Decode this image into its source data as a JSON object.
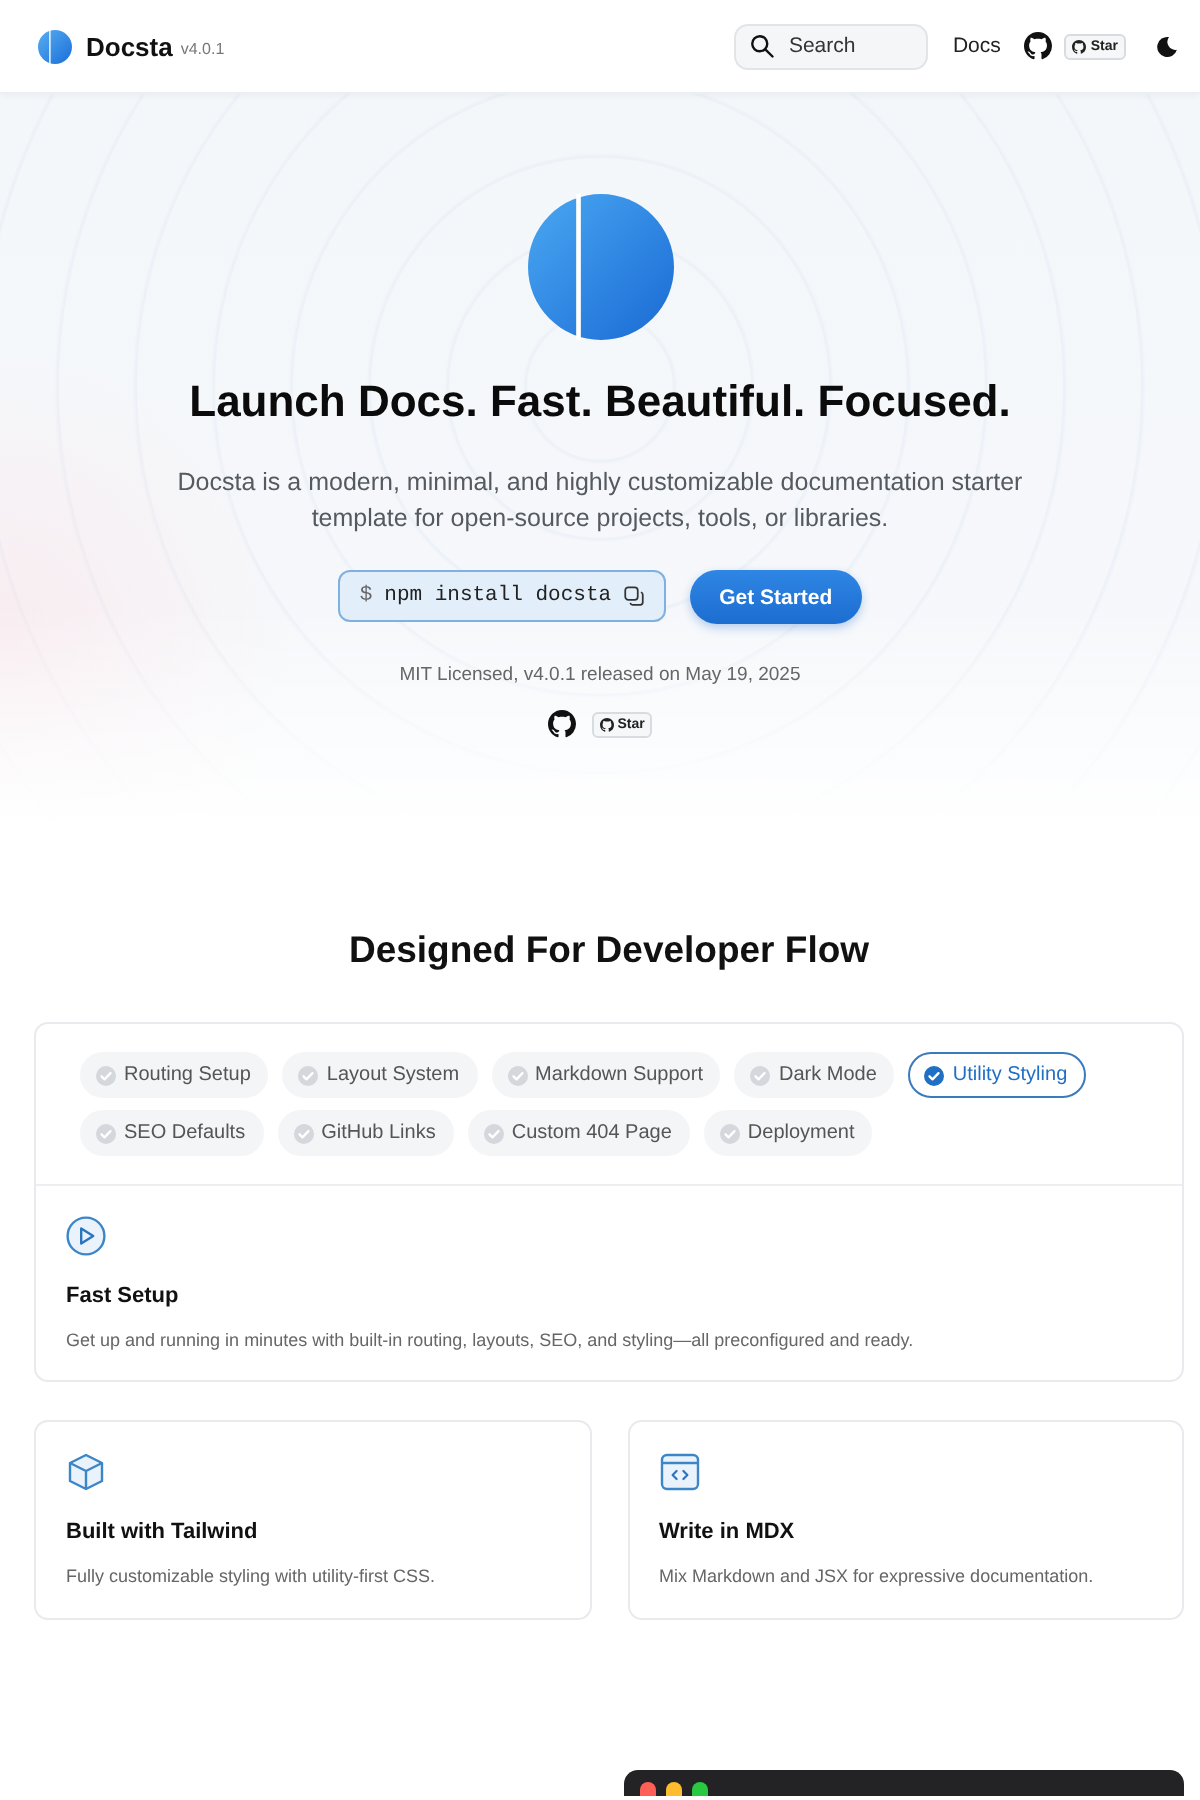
{
  "header": {
    "brand": "Docsta",
    "version": "v4.0.1",
    "search": {
      "placeholder": "Search"
    },
    "nav_link": "Docs",
    "star_button": "Star"
  },
  "hero": {
    "title": "Launch Docs. Fast. Beautiful. Focused.",
    "description": "Docsta is a modern, minimal, and highly customizable documentation starter template for open-source projects, tools, or libraries.",
    "install": {
      "prompt": "$",
      "command": "npm install docsta"
    },
    "cta": "Get Started",
    "release_note": "MIT Licensed, v4.0.1 released on May 19, 2025",
    "star_button": "Star"
  },
  "features": {
    "heading": "Designed For Developer Flow",
    "tabs": [
      {
        "label": "Routing Setup",
        "selected": false
      },
      {
        "label": "Layout System",
        "selected": false
      },
      {
        "label": "Markdown Support",
        "selected": false
      },
      {
        "label": "Dark Mode",
        "selected": false
      },
      {
        "label": "Utility Styling",
        "selected": true
      },
      {
        "label": "SEO Defaults",
        "selected": false
      },
      {
        "label": "GitHub Links",
        "selected": false
      },
      {
        "label": "Custom 404 Page",
        "selected": false
      },
      {
        "label": "Deployment",
        "selected": false
      }
    ],
    "panel": {
      "title": "Fast Setup",
      "description": "Get up and running in minutes with built-in routing, layouts, SEO, and styling—all preconfigured and ready."
    },
    "cards": [
      {
        "title": "Built with Tailwind",
        "description": "Fully customizable styling with utility-first CSS."
      },
      {
        "title": "Write in MDX",
        "description": "Mix Markdown and JSX for expressive documentation."
      }
    ]
  }
}
